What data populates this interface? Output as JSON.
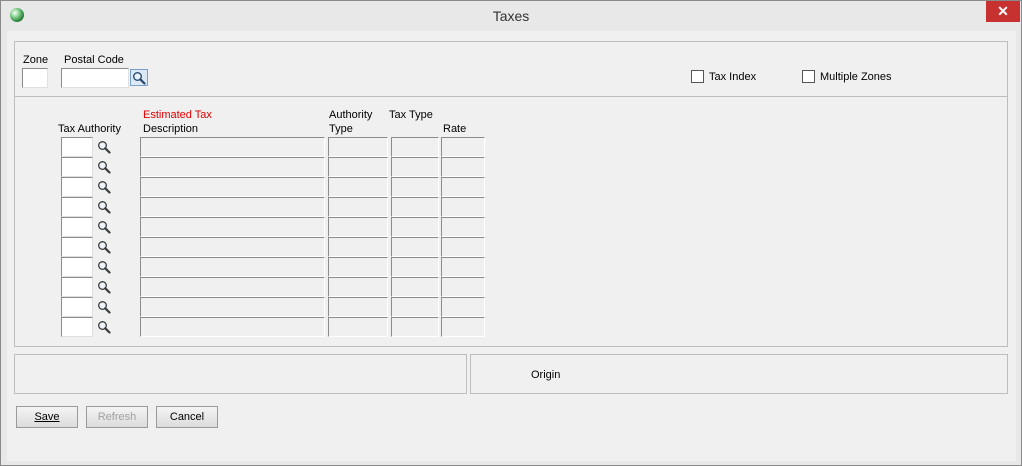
{
  "window": {
    "title": "Taxes",
    "close_glyph": "✕"
  },
  "header": {
    "zone_label": "Zone",
    "zone_value": "",
    "postal_code_label": "Postal Code",
    "postal_code_value": "",
    "tax_index_label": "Tax Index",
    "tax_index_checked": false,
    "multiple_zones_label": "Multiple Zones",
    "multiple_zones_checked": false
  },
  "grid": {
    "columns": {
      "tax_authority": "Tax Authority",
      "estimated_tax": "Estimated Tax",
      "description": "Description",
      "authority_line1": "Authority",
      "authority_line2": "Type",
      "tax_type": "Tax Type",
      "rate": "Rate"
    },
    "rows": [
      {
        "authority": "",
        "description": "",
        "authority_type": "",
        "tax_type": "",
        "rate": ""
      },
      {
        "authority": "",
        "description": "",
        "authority_type": "",
        "tax_type": "",
        "rate": ""
      },
      {
        "authority": "",
        "description": "",
        "authority_type": "",
        "tax_type": "",
        "rate": ""
      },
      {
        "authority": "",
        "description": "",
        "authority_type": "",
        "tax_type": "",
        "rate": ""
      },
      {
        "authority": "",
        "description": "",
        "authority_type": "",
        "tax_type": "",
        "rate": ""
      },
      {
        "authority": "",
        "description": "",
        "authority_type": "",
        "tax_type": "",
        "rate": ""
      },
      {
        "authority": "",
        "description": "",
        "authority_type": "",
        "tax_type": "",
        "rate": ""
      },
      {
        "authority": "",
        "description": "",
        "authority_type": "",
        "tax_type": "",
        "rate": ""
      },
      {
        "authority": "",
        "description": "",
        "authority_type": "",
        "tax_type": "",
        "rate": ""
      },
      {
        "authority": "",
        "description": "",
        "authority_type": "",
        "tax_type": "",
        "rate": ""
      }
    ]
  },
  "bottom": {
    "origin_label": "Origin"
  },
  "buttons": {
    "save_label": "Save",
    "refresh_label": "Refresh",
    "cancel_label": "Cancel"
  },
  "icons": {
    "app": "app-icon",
    "lookup": "magnifier-icon",
    "close": "close-icon"
  },
  "colors": {
    "close_bg": "#c7312f",
    "required_label": "#e00000",
    "lookup_button_bg": "#dbe8f5"
  }
}
